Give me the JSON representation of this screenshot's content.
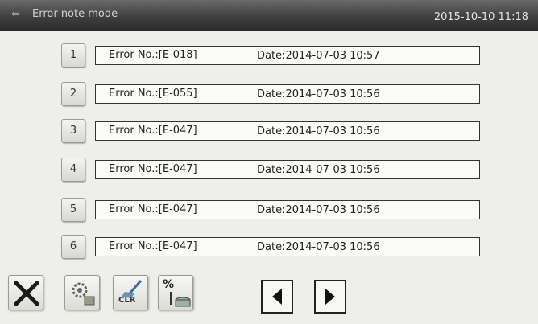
{
  "header": {
    "title": "Error note mode",
    "clock": "2015-10-10 11:18"
  },
  "records": [
    {
      "num": "1",
      "error": "Error No.:[E-018]",
      "date": "Date:2014-07-03  10:57"
    },
    {
      "num": "2",
      "error": "Error No.:[E-055]",
      "date": "Date:2014-07-03  10:56"
    },
    {
      "num": "3",
      "error": "Error No.:[E-047]",
      "date": "Date:2014-07-03  10:56"
    },
    {
      "num": "4",
      "error": "Error No.:[E-047]",
      "date": "Date:2014-07-03  10:56"
    },
    {
      "num": "5",
      "error": "Error No.:[E-047]",
      "date": "Date:2014-07-03  10:56"
    },
    {
      "num": "6",
      "error": "Error No.:[E-047]",
      "date": "Date:2014-07-03  10:56"
    }
  ],
  "toolbar": {
    "clear_label": "CLR",
    "percent_label": "%"
  }
}
